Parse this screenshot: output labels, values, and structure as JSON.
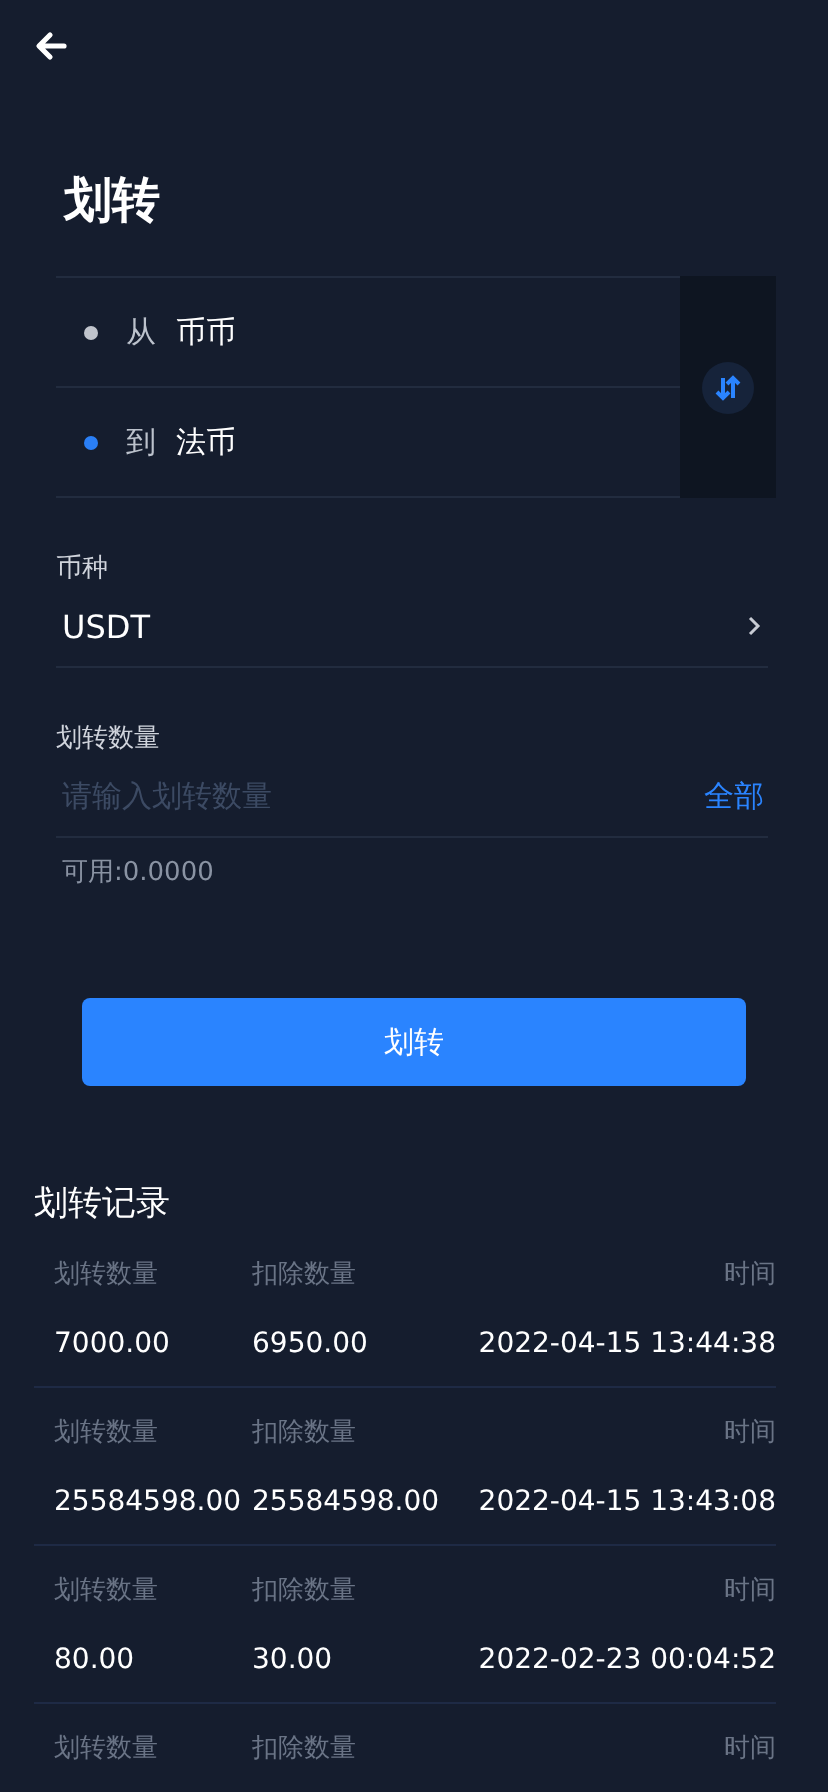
{
  "title": "划转",
  "endpoints": [
    {
      "prefix": "从",
      "account": "币币",
      "color": "#c0c4cc"
    },
    {
      "prefix": "到",
      "account": "法币",
      "color": "#2a7ff6"
    }
  ],
  "currency": {
    "label": "币种",
    "value": "USDT"
  },
  "amount": {
    "label": "划转数量",
    "placeholder": "请输入划转数量",
    "all": "全部",
    "available": "可用:0.0000"
  },
  "submit": "划转",
  "records": {
    "title": "划转记录",
    "rows": [
      {
        "labels": [
          "划转数量",
          "扣除数量",
          "时间"
        ],
        "values": [
          "7000.00",
          "6950.00",
          "2022-04-15 13:44:38"
        ]
      },
      {
        "labels": [
          "划转数量",
          "扣除数量",
          "时间"
        ],
        "values": [
          "25584598.00",
          "25584598.00",
          "2022-04-15 13:43:08"
        ]
      },
      {
        "labels": [
          "划转数量",
          "扣除数量",
          "时间"
        ],
        "values": [
          "80.00",
          "30.00",
          "2022-02-23 00:04:52"
        ]
      },
      {
        "labels": [
          "划转数量",
          "扣除数量",
          "时间"
        ]
      }
    ]
  }
}
